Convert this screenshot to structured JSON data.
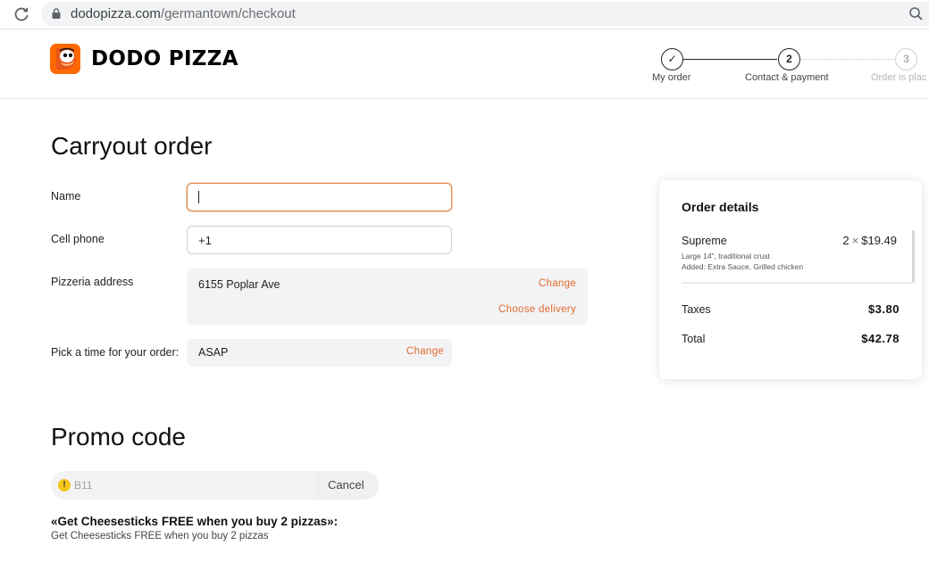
{
  "browser": {
    "url_host": "dodopizza.com",
    "url_path": "/germantown/checkout"
  },
  "header": {
    "brand": "DODO PIZZA",
    "steps": [
      {
        "marker": "✓",
        "label": "My order",
        "state": "done"
      },
      {
        "marker": "2",
        "label": "Contact & payment",
        "state": "active"
      },
      {
        "marker": "3",
        "label": "Order is plac",
        "state": "inactive"
      }
    ]
  },
  "form": {
    "title": "Carryout order",
    "name_label": "Name",
    "name_value": "",
    "phone_label": "Cell phone",
    "phone_value": "+1",
    "address_label": "Pizzeria address",
    "address_value": "6155 Poplar Ave",
    "address_change": "Change",
    "choose_delivery": "Choose delivery",
    "time_label": "Pick a time for your order:",
    "time_value": "ASAP",
    "time_change": "Change"
  },
  "order": {
    "title": "Order details",
    "item_name": "Supreme",
    "item_qty": "2",
    "item_price": "$19.49",
    "item_detail_1": "Large 14\", traditional crust",
    "item_detail_2": "Added: Extra Sauce, Grilled chicken",
    "taxes_label": "Taxes",
    "taxes_value": "$3.80",
    "total_label": "Total",
    "total_value": "$42.78"
  },
  "promo": {
    "title": "Promo code",
    "code": "B11",
    "cancel": "Cancel",
    "offer_title": "«Get Cheesesticks FREE when you buy 2 pizzas»:",
    "offer_desc": "Get Cheesesticks FREE when you buy 2 pizzas"
  },
  "colors": {
    "accent": "#e06a2c",
    "brand": "#ff6900",
    "warning": "#f5c518"
  }
}
